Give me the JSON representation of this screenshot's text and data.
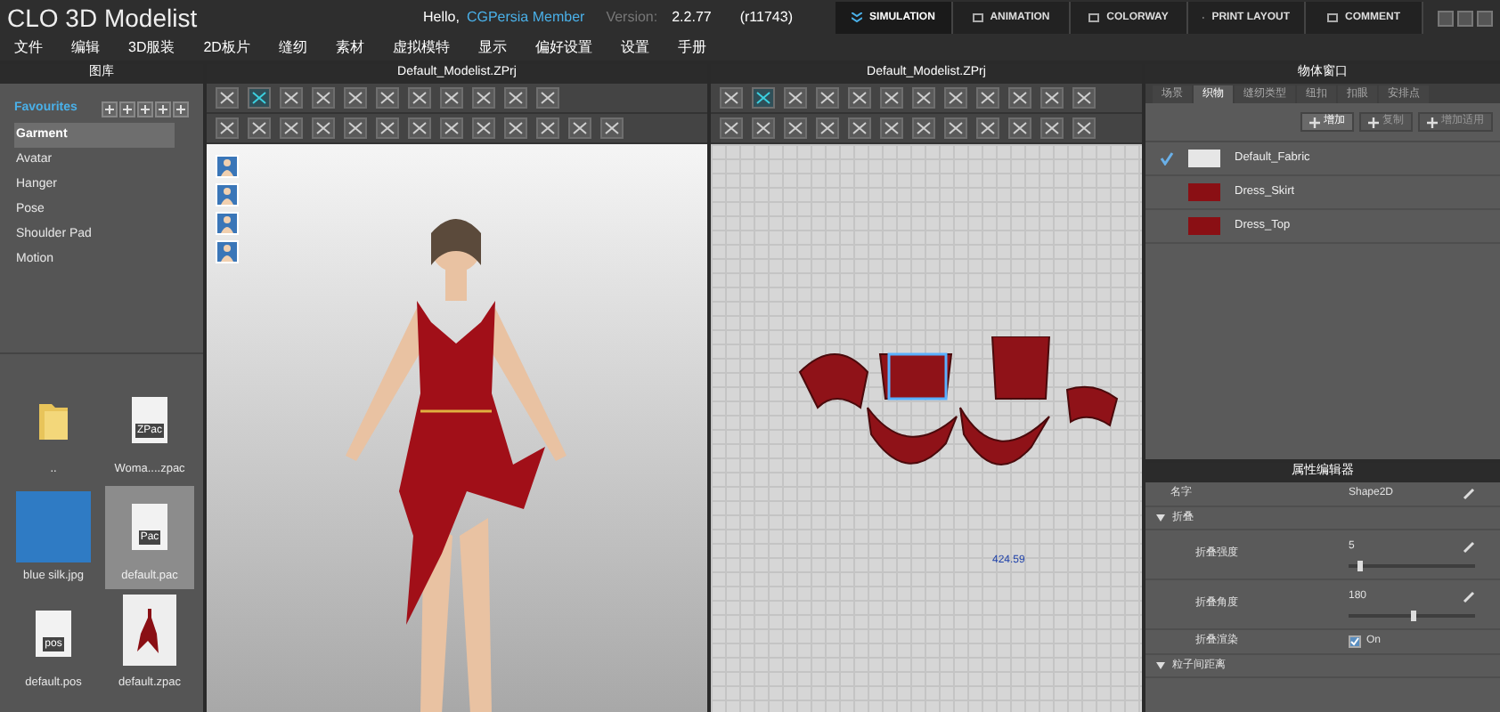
{
  "app": {
    "logo": "CLO 3D Modelist",
    "greeting": "Hello,",
    "user": "CGPersia Member",
    "version_label": "Version:",
    "version": "2.2.77",
    "build": "(r11743)",
    "mode_tabs": [
      {
        "label": "SIMULATION",
        "selected": true
      },
      {
        "label": "ANIMATION",
        "selected": false
      },
      {
        "label": "COLORWAY",
        "selected": false
      },
      {
        "label": "PRINT LAYOUT",
        "selected": false
      },
      {
        "label": "COMMENT",
        "selected": false
      }
    ],
    "menu": [
      "文件",
      "编辑",
      "3D服装",
      "2D板片",
      "缝纫",
      "素材",
      "虚拟模特",
      "显示",
      "偏好设置",
      "设置",
      "手册"
    ]
  },
  "library": {
    "title": "图库",
    "favorites": "Favourites",
    "categories": [
      {
        "label": "Garment",
        "selected": true
      },
      {
        "label": "Avatar",
        "selected": false
      },
      {
        "label": "Hanger",
        "selected": false
      },
      {
        "label": "Pose",
        "selected": false
      },
      {
        "label": "Shoulder Pad",
        "selected": false
      },
      {
        "label": "Motion",
        "selected": false
      }
    ],
    "files": [
      {
        "name": "..",
        "kind": "folder",
        "selected": false
      },
      {
        "name": "Woma....zpac",
        "kind": "doc",
        "tag": "ZPac",
        "selected": false
      },
      {
        "name": "blue silk.jpg",
        "kind": "image",
        "selected": false
      },
      {
        "name": "default.pac",
        "kind": "doc",
        "tag": "Pac",
        "selected": true
      },
      {
        "name": "default.pos",
        "kind": "doc",
        "tag": "pos",
        "selected": false
      },
      {
        "name": "default.zpac",
        "kind": "thumb",
        "selected": false
      }
    ]
  },
  "viewport_3d": {
    "title": "Default_Modelist.ZPrj"
  },
  "pattern_view": {
    "title": "Default_Modelist.ZPrj",
    "measurement": "424.59"
  },
  "object_window": {
    "title": "物体窗口",
    "tabs": [
      {
        "label": "场景",
        "selected": false
      },
      {
        "label": "织物",
        "selected": true
      },
      {
        "label": "缝纫类型",
        "selected": false
      },
      {
        "label": "纽扣",
        "selected": false
      },
      {
        "label": "扣眼",
        "selected": false
      },
      {
        "label": "安排点",
        "selected": false
      }
    ],
    "buttons": [
      "增加",
      "复制",
      "增加适用"
    ],
    "fabrics": [
      {
        "name": "Default_Fabric",
        "color": "#e6e6e6",
        "checked": true
      },
      {
        "name": "Dress_Skirt",
        "color": "#8a0f14",
        "checked": false
      },
      {
        "name": "Dress_Top",
        "color": "#8a0f14",
        "checked": false
      }
    ]
  },
  "property_editor": {
    "title": "属性编辑器",
    "rows": [
      {
        "kind": "text",
        "label": "名字",
        "value": "Shape2D"
      },
      {
        "kind": "section",
        "label": "折叠"
      },
      {
        "kind": "slider",
        "label": "折叠强度",
        "value": "5",
        "level": 0.08
      },
      {
        "kind": "slider",
        "label": "折叠角度",
        "value": "180",
        "level": 0.5
      },
      {
        "kind": "checkbox",
        "label": "折叠渲染",
        "value": "On",
        "checked": true
      },
      {
        "kind": "section",
        "label": "粒子间距离"
      }
    ]
  }
}
